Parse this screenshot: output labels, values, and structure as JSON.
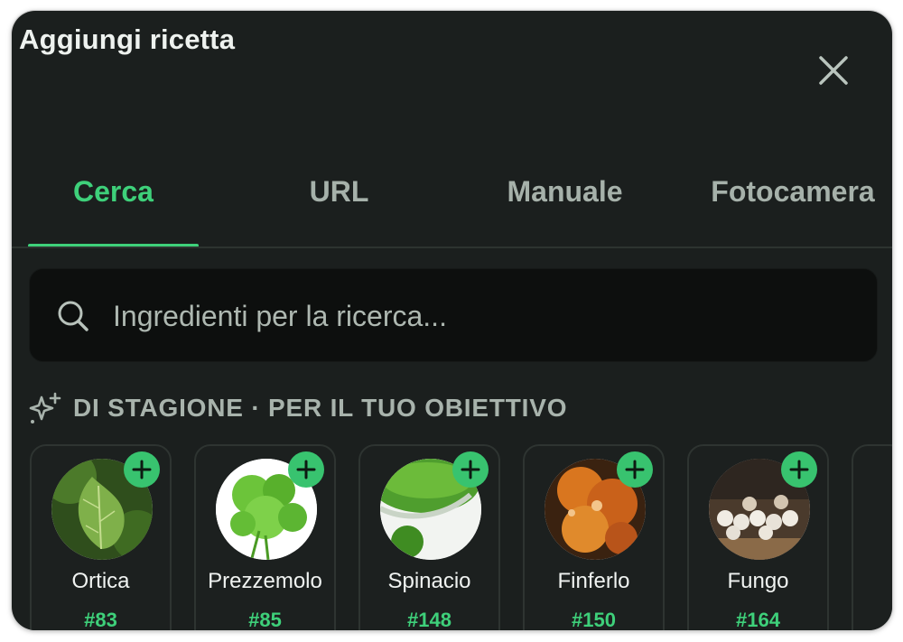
{
  "header": {
    "title": "Aggiungi ricetta",
    "close_icon": "close-icon"
  },
  "tabs": [
    {
      "label": "Cerca",
      "active": true
    },
    {
      "label": "URL",
      "active": false
    },
    {
      "label": "Manuale",
      "active": false
    },
    {
      "label": "Fotocamera",
      "active": false
    }
  ],
  "search": {
    "placeholder": "Ingredienti per la ricerca...",
    "value": "",
    "icon": "search-icon"
  },
  "section": {
    "title": "DI STAGIONE · PER IL TUO OBIETTIVO",
    "icon": "sparkles-icon"
  },
  "ingredients": [
    {
      "name": "Ortica",
      "rank": "#83"
    },
    {
      "name": "Prezzemolo",
      "rank": "#85"
    },
    {
      "name": "Spinacio",
      "rank": "#148"
    },
    {
      "name": "Finferlo",
      "rank": "#150"
    },
    {
      "name": "Fungo",
      "rank": "#164"
    }
  ],
  "colors": {
    "background": "#1b1f1e",
    "accent": "#3ed07a",
    "add_button": "#38c36f",
    "search_bg": "#0d0f0e"
  }
}
